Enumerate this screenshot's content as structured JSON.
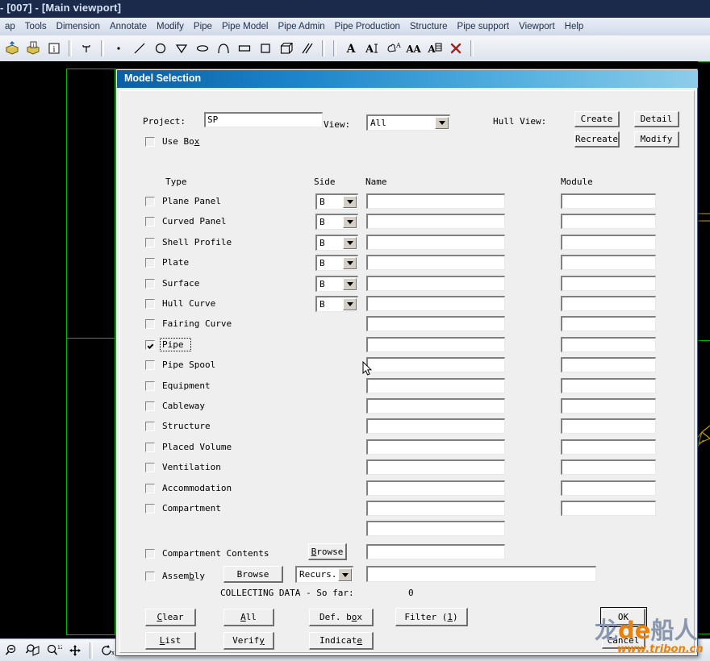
{
  "app": {
    "window_title": "- [007] - [Main viewport]",
    "menus": [
      {
        "label": "ap"
      },
      {
        "label": "Tools"
      },
      {
        "label": "Dimension"
      },
      {
        "label": "Annotate"
      },
      {
        "label": "Modify"
      },
      {
        "label": "Pipe"
      },
      {
        "label": "Pipe Model"
      },
      {
        "label": "Pipe Admin"
      },
      {
        "label": "Pipe Production"
      },
      {
        "label": "Structure"
      },
      {
        "label": "Pipe support"
      },
      {
        "label": "Viewport"
      },
      {
        "label": "Help"
      }
    ],
    "toolbar_icons": [
      "open-model-icon",
      "open-model-info-icon",
      "model-info-icon",
      "separator",
      "text-node-icon",
      "separator",
      "point-icon",
      "line-icon",
      "circle-icon",
      "polyline-icon",
      "ellipse-icon",
      "arc-icon",
      "rectangle-wide-icon",
      "square-icon",
      "box-3d-icon",
      "parallel-lines-icon",
      "separator",
      "text-a-icon",
      "text-edit-icon",
      "text-move-icon",
      "text-font-icon",
      "text-attribute-icon",
      "delete-x-icon"
    ],
    "bottom_toolbar_icons": [
      "zoom-out-icon",
      "zoom-box-icon",
      "zoom-scale-icon",
      "pan-icon",
      "separator",
      "rotate-x-icon",
      "rotate-y-icon"
    ]
  },
  "dialog": {
    "title": "Model Selection",
    "project": {
      "label": "Project:",
      "value": "SP"
    },
    "use_box": {
      "label": "Use Box",
      "checked": false
    },
    "view": {
      "label": "View:",
      "value": "All"
    },
    "hull_view": {
      "label": "Hull View:",
      "buttons": [
        {
          "name": "create",
          "label": "Create"
        },
        {
          "name": "detail",
          "label": "Detail"
        },
        {
          "name": "recreate",
          "label": "Recreate"
        },
        {
          "name": "modify",
          "label": "Modify"
        }
      ]
    },
    "columns": {
      "type": "Type",
      "side": "Side",
      "name": "Name",
      "module": "Module"
    },
    "rows": [
      {
        "type": "Plane Panel",
        "checked": false,
        "side": "B",
        "name": "",
        "module": ""
      },
      {
        "type": "Curved Panel",
        "checked": false,
        "side": "B",
        "name": "",
        "module": ""
      },
      {
        "type": "Shell Profile",
        "checked": false,
        "side": "B",
        "name": "",
        "module": ""
      },
      {
        "type": "Plate",
        "checked": false,
        "side": "B",
        "name": "",
        "module": ""
      },
      {
        "type": "Surface",
        "checked": false,
        "side": "B",
        "name": "",
        "module": ""
      },
      {
        "type": "Hull Curve",
        "checked": false,
        "side": "B",
        "name": "",
        "module": ""
      },
      {
        "type": "Fairing Curve",
        "checked": false,
        "side": null,
        "name": "",
        "module": ""
      },
      {
        "type": "Pipe",
        "checked": true,
        "side": null,
        "name": "",
        "module": ""
      },
      {
        "type": "Pipe Spool",
        "checked": false,
        "side": null,
        "name": "",
        "module": ""
      },
      {
        "type": "Equipment",
        "checked": false,
        "side": null,
        "name": "",
        "module": ""
      },
      {
        "type": "Cableway",
        "checked": false,
        "side": null,
        "name": "",
        "module": ""
      },
      {
        "type": "Structure",
        "checked": false,
        "side": null,
        "name": "",
        "module": ""
      },
      {
        "type": "Placed Volume",
        "checked": false,
        "side": null,
        "name": "",
        "module": ""
      },
      {
        "type": "Ventilation",
        "checked": false,
        "side": null,
        "name": "",
        "module": ""
      },
      {
        "type": "Accommodation",
        "checked": false,
        "side": null,
        "name": "",
        "module": ""
      },
      {
        "type": "Compartment",
        "checked": false,
        "side": null,
        "name": "",
        "module": ""
      },
      {
        "type": "",
        "checked": null,
        "side": null,
        "name": "",
        "module": null
      }
    ],
    "compartment_contents": {
      "label": "Compartment Contents",
      "checked": false,
      "browse_label": "Browse",
      "value": ""
    },
    "assembly": {
      "label": "Assembly",
      "checked": false,
      "browse_label": "Browse",
      "mode": "Recurs.",
      "value": ""
    },
    "status": {
      "text": "COLLECTING DATA - So far:",
      "count": "0"
    },
    "action_buttons": [
      {
        "name": "clear",
        "label": "Clear"
      },
      {
        "name": "all",
        "label": "All"
      },
      {
        "name": "def-box",
        "label": "Def. box"
      },
      {
        "name": "filter",
        "label": "Filter (1)"
      },
      {
        "name": "list",
        "label": "List"
      },
      {
        "name": "verify",
        "label": "Verify"
      },
      {
        "name": "indicate",
        "label": "Indicate"
      }
    ],
    "ok_label": "OK",
    "cancel_label": "Cancel"
  },
  "watermark": {
    "text_1": "龙",
    "text_2": "de",
    "text_3": "船人",
    "url": "www.tribon.cn"
  },
  "colors": {
    "dialog_title_start": "#0a5fa5",
    "dialog_title_end": "#8ecdea",
    "viewport_bg": "#000000",
    "viewport_line_green": "#00b800",
    "viewport_line_yellow": "#c8a000",
    "app_titlebar": "#1b2a4a",
    "accent_orange": "#e8820c"
  }
}
